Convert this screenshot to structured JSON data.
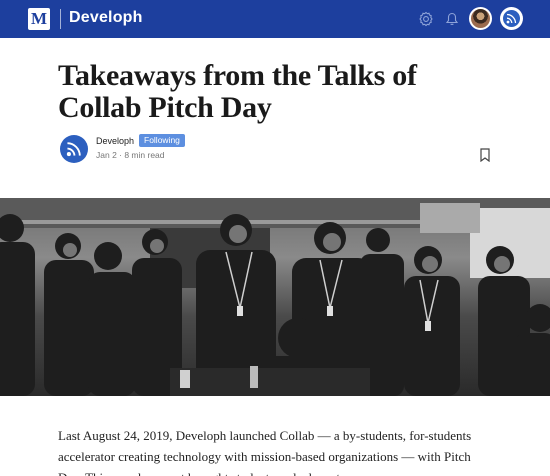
{
  "topbar": {
    "logo_letter": "M",
    "publication": "Developh",
    "icons": [
      "gear-icon",
      "bell-icon",
      "user-avatar",
      "publication-avatar"
    ],
    "bar_color": "#1d3f9e"
  },
  "article": {
    "title": "Takeaways from the Talks of Collab Pitch Day",
    "author": "Developh",
    "follow_label": "Following",
    "meta": "Jan 2 · 8 min read",
    "body": "Last August 24, 2019, Developh launched Collab — a by-students, for-students accelerator creating technology with mission-based organizations — with Pitch Day. This one-day event brought students and advocates"
  },
  "hero_image": {
    "description_icon": "event-photo",
    "tone": "black-and-white"
  },
  "colors": {
    "accent": "#1d3f9e",
    "badge": "#5d8fe0",
    "brand_blue": "#2c5fbf"
  }
}
